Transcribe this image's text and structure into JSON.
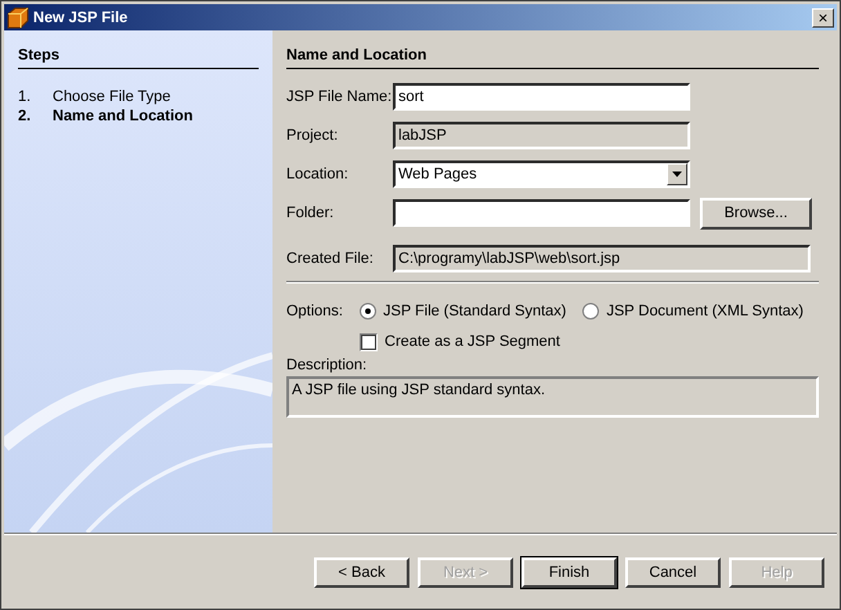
{
  "window": {
    "title": "New JSP File",
    "close": "×"
  },
  "steps": {
    "heading": "Steps",
    "items": [
      {
        "number": "1.",
        "label": "Choose File Type",
        "selected": false
      },
      {
        "number": "2.",
        "label": "Name and Location",
        "selected": true
      }
    ]
  },
  "panel": {
    "heading": "Name and Location",
    "fields": [
      {
        "kind": "text",
        "label": "JSP File Name:",
        "value": "sort"
      },
      {
        "kind": "readonly",
        "label": "Project:",
        "value": "labJSP"
      },
      {
        "kind": "combo",
        "label": "Location:",
        "value": "Web Pages"
      },
      {
        "kind": "browse",
        "label": "Folder:",
        "button": "Browse..."
      },
      {
        "kind": "readonly-wide",
        "label": "Created File:",
        "value": "C:\\programy\\labJSP\\web\\sort.jsp"
      }
    ],
    "options_label": "Options:",
    "radios": [
      {
        "label": "JSP File (Standard Syntax)",
        "selected": true
      },
      {
        "label": "JSP Document (XML Syntax)",
        "selected": false
      }
    ],
    "checkbox": {
      "label": "Create as a JSP Segment",
      "checked": false
    },
    "description_label": "Description:",
    "description": "A JSP file using JSP standard syntax."
  },
  "buttons": [
    {
      "label": "< Back",
      "disabled": false,
      "default": false
    },
    {
      "label": "Next >",
      "disabled": true,
      "default": false
    },
    {
      "label": "Finish",
      "disabled": false,
      "default": true
    },
    {
      "label": "Cancel",
      "disabled": false,
      "default": false
    },
    {
      "label": "Help",
      "disabled": true,
      "default": false
    }
  ]
}
